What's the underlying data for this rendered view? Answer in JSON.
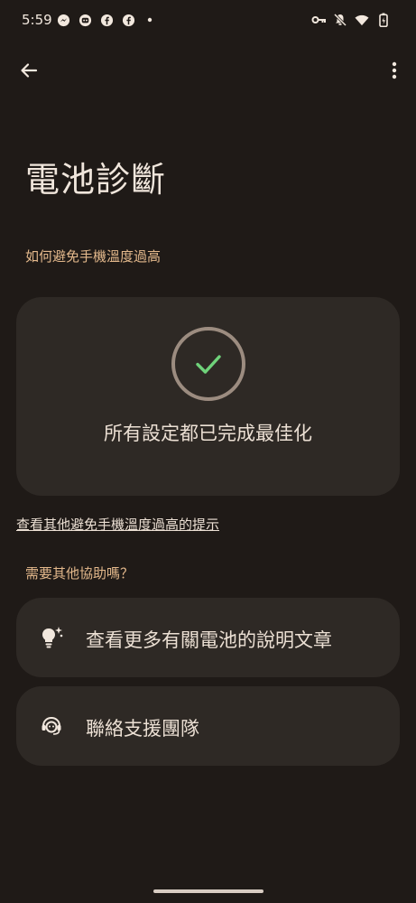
{
  "status_bar": {
    "time": "5:59",
    "left_icons": [
      "messenger-icon",
      "app-notification-icon",
      "facebook-icon",
      "facebook-icon",
      "dot-icon"
    ],
    "right_icons": [
      "vpn-key-icon",
      "mute-icon",
      "wifi-icon",
      "battery-icon"
    ]
  },
  "app_bar": {
    "back_icon": "arrow-back-icon",
    "more_icon": "more-vert-icon"
  },
  "page": {
    "title": "電池診斷",
    "section_heat": "如何避免手機溫度過高",
    "status_message": "所有設定都已完成最佳化",
    "tips_link": "查看其他避免手機溫度過高的提示",
    "section_help": "需要其他協助嗎？",
    "help_items": [
      {
        "label": "查看更多有關電池的說明文章",
        "icon": "lightbulb-icon"
      },
      {
        "label": "聯絡支援團隊",
        "icon": "support-agent-icon"
      }
    ]
  },
  "colors": {
    "background": "#1f1a17",
    "card": "#2e2925",
    "accent_label": "#e4b98c",
    "check": "#6fd27a",
    "ring": "#9c8c80"
  }
}
